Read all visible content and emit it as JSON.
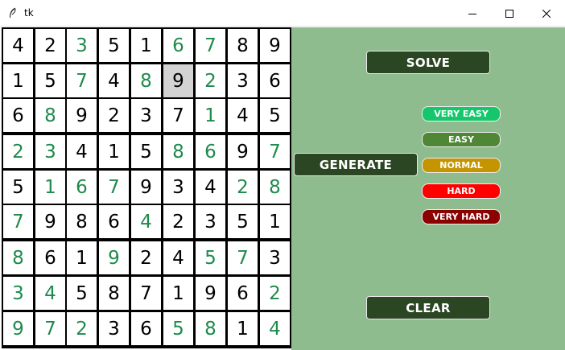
{
  "window": {
    "title": "tk",
    "controls": {
      "minimize": "minimize-icon",
      "maximize": "maximize-icon",
      "close": "close-icon"
    }
  },
  "sudoku": {
    "grid": [
      [
        4,
        2,
        3,
        5,
        1,
        6,
        7,
        8,
        9
      ],
      [
        1,
        5,
        7,
        4,
        8,
        9,
        2,
        3,
        6
      ],
      [
        6,
        8,
        9,
        2,
        3,
        7,
        1,
        4,
        5
      ],
      [
        2,
        3,
        4,
        1,
        5,
        8,
        6,
        9,
        7
      ],
      [
        5,
        1,
        6,
        7,
        9,
        3,
        4,
        2,
        8
      ],
      [
        7,
        9,
        8,
        6,
        4,
        2,
        3,
        5,
        1
      ],
      [
        8,
        6,
        1,
        9,
        2,
        4,
        5,
        7,
        3
      ],
      [
        3,
        4,
        5,
        8,
        7,
        1,
        9,
        6,
        2
      ],
      [
        9,
        7,
        2,
        3,
        6,
        5,
        8,
        1,
        4
      ]
    ],
    "solved_mask": [
      [
        0,
        0,
        1,
        0,
        0,
        1,
        1,
        0,
        0
      ],
      [
        0,
        0,
        1,
        0,
        1,
        0,
        1,
        0,
        0
      ],
      [
        0,
        1,
        0,
        0,
        0,
        0,
        1,
        0,
        0
      ],
      [
        1,
        1,
        0,
        0,
        0,
        1,
        1,
        0,
        1
      ],
      [
        0,
        1,
        1,
        1,
        0,
        0,
        0,
        1,
        1
      ],
      [
        1,
        0,
        0,
        0,
        1,
        0,
        0,
        0,
        0
      ],
      [
        1,
        0,
        0,
        1,
        0,
        0,
        1,
        1,
        0
      ],
      [
        1,
        1,
        0,
        0,
        0,
        0,
        0,
        0,
        1
      ],
      [
        1,
        1,
        1,
        0,
        0,
        1,
        1,
        0,
        1
      ]
    ],
    "selected_cell": {
      "row": 1,
      "col": 5
    },
    "colors": {
      "given": "#000000",
      "solved": "#1f8a4c",
      "selected_bg": "#d3d3d3"
    }
  },
  "controls": {
    "solve_label": "SOLVE",
    "generate_label": "GENERATE",
    "clear_label": "CLEAR",
    "difficulties": [
      {
        "label": "VERY EASY",
        "color": "#13c76a"
      },
      {
        "label": "EASY",
        "color": "#4f8736"
      },
      {
        "label": "NORMAL",
        "color": "#c49500"
      },
      {
        "label": "HARD",
        "color": "#ff0000"
      },
      {
        "label": "VERY HARD",
        "color": "#8b0000"
      }
    ]
  },
  "theme": {
    "panel_bg": "#8fbc8f",
    "button_bg": "#2b4622"
  }
}
